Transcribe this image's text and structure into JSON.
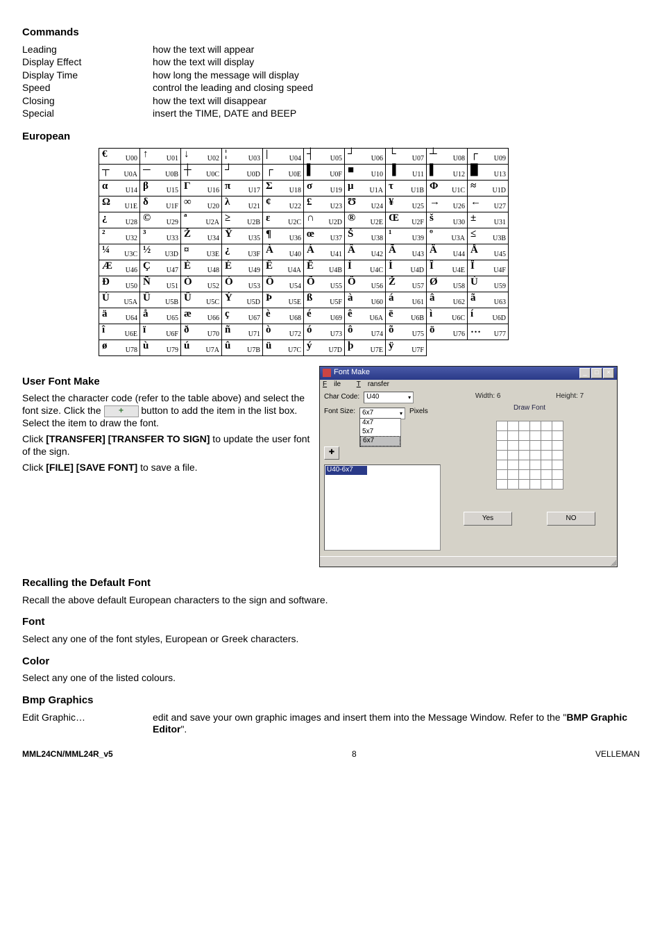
{
  "headings": {
    "commands": "Commands",
    "european": "European",
    "userfont": "User Font Make",
    "recall": "Recalling the Default Font",
    "font": "Font",
    "color": "Color",
    "bmp": "Bmp Graphics"
  },
  "commands": [
    {
      "name": "Leading",
      "desc": "how the text will appear"
    },
    {
      "name": "Display Effect",
      "desc": "how the text will display"
    },
    {
      "name": "Display Time",
      "desc": "how long the message will display"
    },
    {
      "name": "Speed",
      "desc": "control the leading and closing speed"
    },
    {
      "name": "Closing",
      "desc": "how the text will disappear"
    },
    {
      "name": "Special",
      "desc": "insert the TIME, DATE and BEEP"
    }
  ],
  "euro_rows": [
    [
      [
        "€",
        "U00"
      ],
      [
        "↑",
        "U01"
      ],
      [
        "↓",
        "U02"
      ],
      [
        "¦",
        "U03"
      ],
      [
        "|",
        "U04"
      ],
      [
        "┤",
        "U05"
      ],
      [
        "┘",
        "U06"
      ],
      [
        "└",
        "U07"
      ],
      [
        "┴",
        "U08"
      ],
      [
        "┌",
        "U09"
      ]
    ],
    [
      [
        "┬",
        "U0A"
      ],
      [
        "─",
        "U0B"
      ],
      [
        "┼",
        "U0C"
      ],
      [
        "┘",
        "U0D"
      ],
      [
        "┌",
        "U0E"
      ],
      [
        "▌",
        "U0F"
      ],
      [
        "■",
        "U10"
      ],
      [
        "▐",
        "U11"
      ],
      [
        "▌",
        "U12"
      ],
      [
        "█",
        "U13"
      ]
    ],
    [
      [
        "α",
        "U14"
      ],
      [
        "β",
        "U15"
      ],
      [
        "Γ",
        "U16"
      ],
      [
        "π",
        "U17"
      ],
      [
        "Σ",
        "U18"
      ],
      [
        "σ",
        "U19"
      ],
      [
        "μ",
        "U1A"
      ],
      [
        "τ",
        "U1B"
      ],
      [
        "Φ",
        "U1C"
      ],
      [
        "≈",
        "U1D"
      ]
    ],
    [
      [
        "Ω",
        "U1E"
      ],
      [
        "δ",
        "U1F"
      ],
      [
        "∞",
        "U20"
      ],
      [
        "λ",
        "U21"
      ],
      [
        "¢",
        "U22"
      ],
      [
        "£",
        "U23"
      ],
      [
        "Ʊ",
        "U24"
      ],
      [
        "¥",
        "U25"
      ],
      [
        "→",
        "U26"
      ],
      [
        "←",
        "U27"
      ]
    ],
    [
      [
        "¿",
        "U28"
      ],
      [
        "©",
        "U29"
      ],
      [
        "ª",
        "U2A"
      ],
      [
        "≥",
        "U2B"
      ],
      [
        "ɛ",
        "U2C"
      ],
      [
        "∩",
        "U2D"
      ],
      [
        "®",
        "U2E"
      ],
      [
        "Œ",
        "U2F"
      ],
      [
        "š",
        "U30"
      ],
      [
        "±",
        "U31"
      ]
    ],
    [
      [
        "²",
        "U32"
      ],
      [
        "³",
        "U33"
      ],
      [
        "Ž",
        "U34"
      ],
      [
        "Ÿ",
        "U35"
      ],
      [
        "¶",
        "U36"
      ],
      [
        "œ",
        "U37"
      ],
      [
        "Š",
        "U38"
      ],
      [
        "¹",
        "U39"
      ],
      [
        "º",
        "U3A"
      ],
      [
        "≤",
        "U3B"
      ]
    ],
    [
      [
        "¼",
        "U3C"
      ],
      [
        "½",
        "U3D"
      ],
      [
        "¤",
        "U3E"
      ],
      [
        "¿",
        "U3F"
      ],
      [
        "À",
        "U40"
      ],
      [
        "Á",
        "U41"
      ],
      [
        "Â",
        "U42"
      ],
      [
        "Ã",
        "U43"
      ],
      [
        "Ä",
        "U44"
      ],
      [
        "Å",
        "U45"
      ]
    ],
    [
      [
        "Æ",
        "U46"
      ],
      [
        "Ç",
        "U47"
      ],
      [
        "È",
        "U48"
      ],
      [
        "É",
        "U49"
      ],
      [
        "Ê",
        "U4A"
      ],
      [
        "Ë",
        "U4B"
      ],
      [
        "Ì",
        "U4C"
      ],
      [
        "Í",
        "U4D"
      ],
      [
        "Î",
        "U4E"
      ],
      [
        "Ï",
        "U4F"
      ]
    ],
    [
      [
        "Ð",
        "U50"
      ],
      [
        "Ñ",
        "U51"
      ],
      [
        "Ò",
        "U52"
      ],
      [
        "Ó",
        "U53"
      ],
      [
        "Ô",
        "U54"
      ],
      [
        "Õ",
        "U55"
      ],
      [
        "Ö",
        "U56"
      ],
      [
        "Ž",
        "U57"
      ],
      [
        "Ø",
        "U58"
      ],
      [
        "Ù",
        "U59"
      ]
    ],
    [
      [
        "Ú",
        "U5A"
      ],
      [
        "Û",
        "U5B"
      ],
      [
        "Ü",
        "U5C"
      ],
      [
        "Ý",
        "U5D"
      ],
      [
        "Þ",
        "U5E"
      ],
      [
        "ß",
        "U5F"
      ],
      [
        "à",
        "U60"
      ],
      [
        "á",
        "U61"
      ],
      [
        "â",
        "U62"
      ],
      [
        "ã",
        "U63"
      ]
    ],
    [
      [
        "ä",
        "U64"
      ],
      [
        "å",
        "U65"
      ],
      [
        "æ",
        "U66"
      ],
      [
        "ç",
        "U67"
      ],
      [
        "è",
        "U68"
      ],
      [
        "é",
        "U69"
      ],
      [
        "ê",
        "U6A"
      ],
      [
        "ë",
        "U6B"
      ],
      [
        "ì",
        "U6C"
      ],
      [
        "í",
        "U6D"
      ]
    ],
    [
      [
        "î",
        "U6E"
      ],
      [
        "ï",
        "U6F"
      ],
      [
        "ð",
        "U70"
      ],
      [
        "ñ",
        "U71"
      ],
      [
        "ò",
        "U72"
      ],
      [
        "ó",
        "U73"
      ],
      [
        "ô",
        "U74"
      ],
      [
        "õ",
        "U75"
      ],
      [
        "ö",
        "U76"
      ],
      [
        "…",
        "U77"
      ]
    ],
    [
      [
        "ø",
        "U78"
      ],
      [
        "ù",
        "U79"
      ],
      [
        "ú",
        "U7A"
      ],
      [
        "û",
        "U7B"
      ],
      [
        "ü",
        "U7C"
      ],
      [
        "ý",
        "U7D"
      ],
      [
        "þ",
        "U7E"
      ],
      [
        "ÿ",
        "U7F"
      ],
      [
        "",
        ""
      ],
      [
        "",
        ""
      ]
    ]
  ],
  "userfont": {
    "p1a": "Select the character code (refer to the table above) and select the font size. Click the ",
    "p1b": " button to add the item in the list box. Select the item to draw the font.",
    "p2a": "Click ",
    "p2b": "[TRANSFER] [TRANSFER TO SIGN]",
    "p2c": " to update the user font of the sign.",
    "p3a": "Click ",
    "p3b": "[FILE] [SAVE FONT]",
    "p3c": " to save a file."
  },
  "recall_text": "Recall the above default European characters to the sign and software.",
  "font_text": "Select any one of the font styles, European or Greek characters.",
  "color_text": "Select any one of the listed colours.",
  "bmp": {
    "label": "Edit Graphic…",
    "desc_a": "edit and save your own graphic images and insert them into the Message Window. Refer to the \"",
    "desc_b": "BMP Graphic Editor",
    "desc_c": "\"."
  },
  "window": {
    "title": "Font Make",
    "menu_file": "File",
    "menu_transfer": "Transfer",
    "char_code_label": "Char Code:",
    "char_code_value": "U40",
    "font_size_label": "Font Size:",
    "font_size_value": "6x7",
    "pixels_label": "Pixels",
    "size_options": [
      "4x7",
      "5x7",
      "6x7"
    ],
    "list_item": "U40-6x7",
    "width_label": "Width: 6",
    "height_label": "Height: 7",
    "draw_font": "Draw Font",
    "yes": "Yes",
    "no": "NO"
  },
  "footer": {
    "left": "MML24CN/MML24R_v5",
    "center": "8",
    "right": "VELLEMAN"
  }
}
